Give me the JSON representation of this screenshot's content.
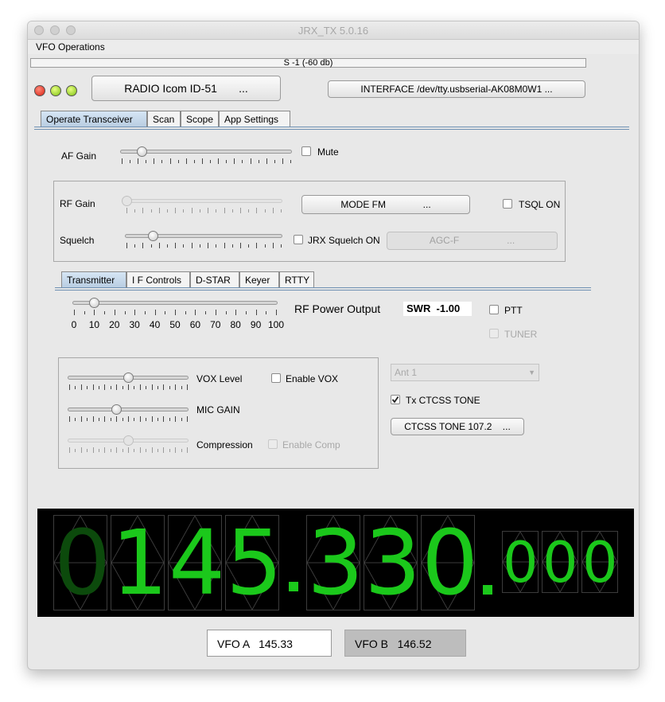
{
  "window": {
    "title": "JRX_TX 5.0.16"
  },
  "menu": {
    "vfo_operations": "VFO Operations"
  },
  "signal": {
    "text": "S -1 (-60 db)"
  },
  "header": {
    "radio_button": "RADIO Icom ID-51       ...",
    "interface_button": "INTERFACE /dev/tty.usbserial-AK08M0W1 ..."
  },
  "main_tabs": [
    "Operate Transceiver",
    "Scan",
    "Scope",
    "App Settings"
  ],
  "af": {
    "label": "AF Gain",
    "mute_label": "Mute",
    "level": 0.12
  },
  "rf": {
    "label": "RF Gain",
    "level": 0.0,
    "mode_button": "MODE FM              ...",
    "tsql_label": "TSQL ON"
  },
  "squelch": {
    "label": "Squelch",
    "level": 0.17,
    "jrx_label": "JRX Squelch ON",
    "agc_button": "AGC-F                  ..."
  },
  "sub_tabs": [
    "Transmitter",
    "I F Controls",
    "D-STAR",
    "Keyer",
    "RTTY"
  ],
  "tx": {
    "power_label": "RF Power Output",
    "power_level": 0.1,
    "scale_labels": [
      "0",
      "10",
      "20",
      "30",
      "40",
      "50",
      "60",
      "70",
      "80",
      "90",
      "100"
    ],
    "swr": "SWR  -1.00",
    "ptt_label": "PTT",
    "tuner_label": "TUNER"
  },
  "vox": {
    "label": "VOX Level",
    "level": 0.5,
    "enable_label": "Enable VOX"
  },
  "mic": {
    "label": "MIC GAIN",
    "level": 0.4
  },
  "comp": {
    "label": "Compression",
    "level": 0.5,
    "enable_label": "Enable Comp"
  },
  "antenna": {
    "selected": "Ant 1"
  },
  "ctcss": {
    "checkbox_label": "Tx CTCSS TONE",
    "checked": true,
    "button": "CTCSS TONE 107.2    ..."
  },
  "frequency": {
    "digits": [
      "0",
      "1",
      "4",
      "5",
      "3",
      "3",
      "0",
      "0",
      "0",
      "0"
    ],
    "value": "0145.330.000"
  },
  "vfo": {
    "a": "VFO A   145.33",
    "b": "VFO B   146.52"
  },
  "colors": {
    "display_green": "#1bc81b",
    "display_bg": "#000000",
    "tab_selected": "#b9cde2"
  }
}
